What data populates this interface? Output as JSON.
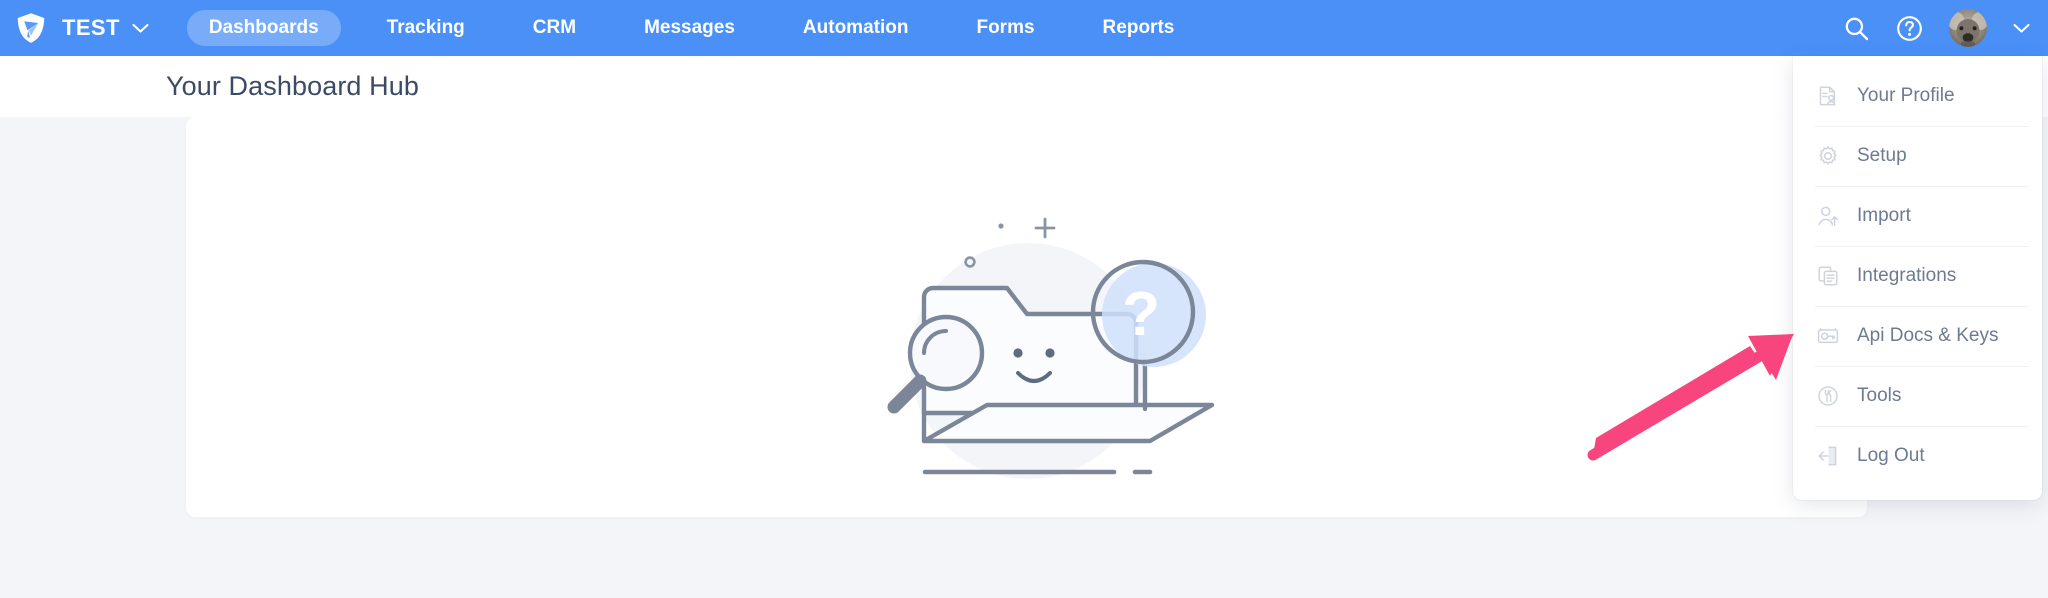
{
  "app": {
    "logo_icon": "shield-play-logo",
    "brand_name": "TEST",
    "brand_chevron_icon": "chevron-down-icon",
    "accent_blue": "#4a90f7",
    "page_background": "#f4f5f9",
    "annotation_color": "#f9457e"
  },
  "nav": {
    "items": [
      {
        "label": "Dashboards",
        "active": true
      },
      {
        "label": "Tracking",
        "active": false
      },
      {
        "label": "CRM",
        "active": false
      },
      {
        "label": "Messages",
        "active": false
      },
      {
        "label": "Automation",
        "active": false
      },
      {
        "label": "Forms",
        "active": false
      },
      {
        "label": "Reports",
        "active": false
      }
    ],
    "right": {
      "search_icon": "search-icon",
      "help_icon": "question-circle-icon",
      "avatar_icon": "user-avatar-photo",
      "avatar_chevron_icon": "chevron-down-icon"
    }
  },
  "page": {
    "title": "Your Dashboard Hub"
  },
  "card": {
    "illustration": "empty-state-folder-magnifier-question"
  },
  "profile_menu": {
    "visible": true,
    "items": [
      {
        "label": "Your Profile",
        "icon": "profile-document-icon"
      },
      {
        "label": "Setup",
        "icon": "gear-icon"
      },
      {
        "label": "Import",
        "icon": "user-import-icon"
      },
      {
        "label": "Integrations",
        "icon": "copy-documents-icon"
      },
      {
        "label": "Api Docs & Keys",
        "icon": "api-key-card-icon"
      },
      {
        "label": "Tools",
        "icon": "wrench-circle-icon"
      },
      {
        "label": "Log Out",
        "icon": "logout-door-icon"
      }
    ]
  },
  "annotation": {
    "arrow": "pink-arrow-pointing-up-right",
    "points_to": "Api Docs & Keys"
  }
}
